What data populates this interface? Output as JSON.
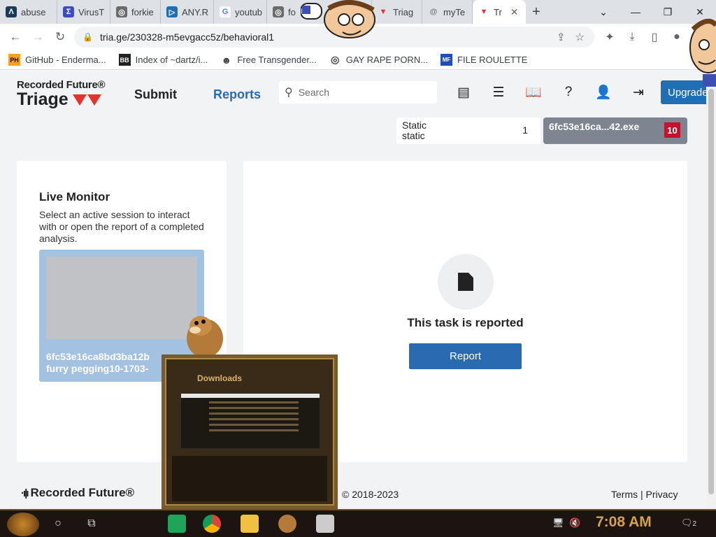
{
  "browser": {
    "tabs": [
      {
        "label": "abuse",
        "fav_color": "#1a3a5a",
        "fav_text": "Λ"
      },
      {
        "label": "VirusT",
        "fav_color": "#3b4fb5",
        "fav_text": "Σ"
      },
      {
        "label": "forkie",
        "fav_color": "#6b6b6b",
        "fav_text": "◎"
      },
      {
        "label": "ANY.R",
        "fav_color": "#1f6fb5",
        "fav_text": "▷"
      },
      {
        "label": "youtub",
        "fav_color": "#ffffff",
        "fav_text": "G"
      },
      {
        "label": "fo",
        "fav_color": "#6b6b6b",
        "fav_text": "◎"
      },
      {
        "label": "Triag",
        "fav_color": "#e5322d",
        "fav_text": "▼"
      },
      {
        "label": "myTe",
        "fav_color": "#777777",
        "fav_text": "@"
      }
    ],
    "active_tab": {
      "label": "Tr",
      "fav_color": "#e5322d",
      "fav_text": "▼"
    },
    "new_tab": "+",
    "url": "tria.ge/230328-m5evgacc5z/behavioral1",
    "bookmarks": [
      {
        "label": "GitHub - Enderma...",
        "icon": "PH"
      },
      {
        "label": "Index of ~dartz/i...",
        "icon": "BB"
      },
      {
        "label": "Free Transgender...",
        "icon": "☻"
      },
      {
        "label": "GAY RAPE PORN...",
        "icon": "◎"
      },
      {
        "label": "FILE ROULETTE",
        "icon": "MF"
      }
    ]
  },
  "app": {
    "brand_top": "Recorded Future®",
    "brand_main": "Triage",
    "nav_submit": "Submit",
    "nav_reports": "Reports",
    "search_placeholder": "Search",
    "upgrade": "Upgrade",
    "static_label_1": "Static",
    "static_label_2": "static",
    "static_count": "1",
    "file_name": "6fc53e16ca...42.exe",
    "file_score": "10",
    "live_monitor_title": "Live Monitor",
    "live_monitor_desc": "Select an active session to interact with or open the report of a completed analysis.",
    "session_title_1": "6fc53e16ca8bd3ba12b",
    "session_title_2": "furry pegging10-1703-",
    "task_status": "This task is reported",
    "report_button": "Report",
    "footer_logo": "Recorded Future®",
    "copyright": "© 2018-2023",
    "terms": "Terms",
    "sep": "|",
    "privacy": "Privacy"
  },
  "overlay": {
    "title": "Downloads"
  },
  "taskbar": {
    "time": "7:08 AM",
    "notif_count": "2"
  },
  "colors": {
    "accent": "#2a6ab1",
    "score": "#c41230",
    "brand_red": "#e5322d"
  }
}
